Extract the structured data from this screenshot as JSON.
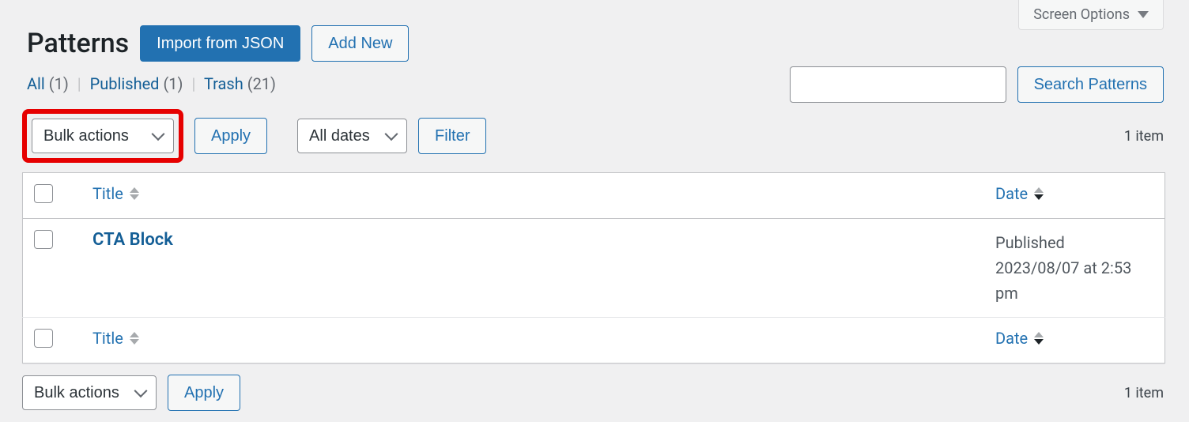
{
  "screen_options_label": "Screen Options",
  "header": {
    "title": "Patterns",
    "import_label": "Import from JSON",
    "addnew_label": "Add New"
  },
  "views": {
    "all_label": "All",
    "all_count": "(1)",
    "published_label": "Published",
    "published_count": "(1)",
    "trash_label": "Trash",
    "trash_count": "(21)",
    "sep": "|"
  },
  "search": {
    "button_label": "Search Patterns",
    "value": ""
  },
  "tablenav": {
    "bulk_label": "Bulk actions",
    "apply_label": "Apply",
    "dates_label": "All dates",
    "filter_label": "Filter",
    "count_label": "1 item"
  },
  "columns": {
    "title": "Title",
    "date": "Date"
  },
  "rows": [
    {
      "title": "CTA Block",
      "status": "Published",
      "date_line": "2023/08/07 at 2:53 pm"
    }
  ]
}
